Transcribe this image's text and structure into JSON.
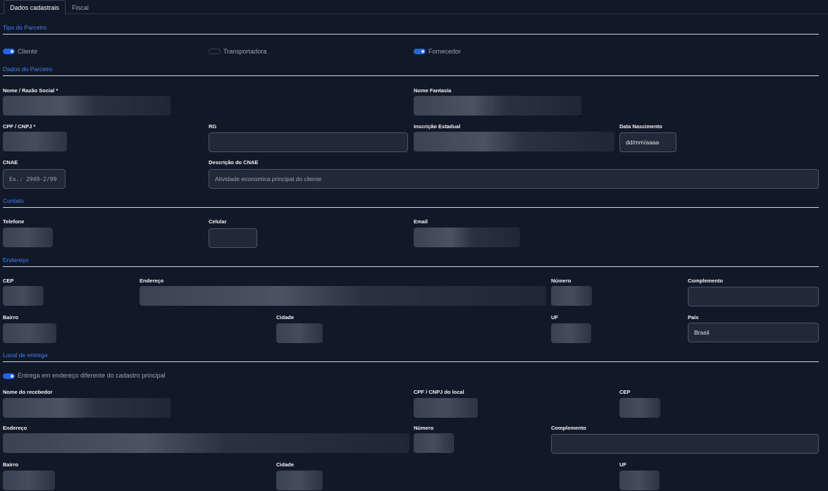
{
  "tabs": {
    "active": "Dados cadastrais",
    "inactive": "Fiscal"
  },
  "sections": {
    "tipo": "Tipo do Parceiro",
    "dados": "Dados do Parceiro",
    "contato": "Contato",
    "endereco": "Endereço",
    "entrega": "Local de entrega"
  },
  "tipo_parceiro": {
    "cliente": {
      "label": "Cliente",
      "on": true
    },
    "transportadora": {
      "label": "Transportadora",
      "on": false
    },
    "fornecedor": {
      "label": "Fornecedor",
      "on": true
    }
  },
  "dados": {
    "nome_label": "Nome / Razão Social *",
    "fantasia_label": "Nome Fantasia",
    "cpf_label": "CPF / CNPJ *",
    "rg_label": "RG",
    "ie_label": "Inscrição Estadual",
    "nasc_label": "Data Nascimento",
    "nasc_value": "dd/mm/aaaa",
    "cnae_label": "CNAE",
    "cnae_placeholder": "Ex.: 2949-2/99",
    "desc_cnae_label": "Descrição do CNAE",
    "desc_cnae_placeholder": "Atividade economica principal do cliente"
  },
  "contato": {
    "telefone_label": "Telefone",
    "celular_label": "Celular",
    "email_label": "Email"
  },
  "endereco": {
    "cep_label": "CEP",
    "endereco_label": "Endereço",
    "numero_label": "Número",
    "complemento_label": "Complemento",
    "bairro_label": "Bairro",
    "cidade_label": "Cidade",
    "uf_label": "UF",
    "pais_label": "País",
    "pais_value": "Brasil"
  },
  "entrega": {
    "toggle_label": "Entrega em endereço diferente do cadastro principal",
    "toggle_on": true,
    "recebedor_label": "Nome do recebedor",
    "cpf_local_label": "CPF / CNPJ do local",
    "cep_label": "CEP",
    "endereco_label": "Endereço",
    "numero_label": "Número",
    "complemento_label": "Complemento",
    "bairro_label": "Bairro",
    "cidade_label": "Cidade",
    "uf_label": "UF"
  },
  "colors": {
    "accent": "#3b82f6",
    "background": "#111827",
    "input": "#1f2937",
    "toggle_on": "#2563eb"
  }
}
